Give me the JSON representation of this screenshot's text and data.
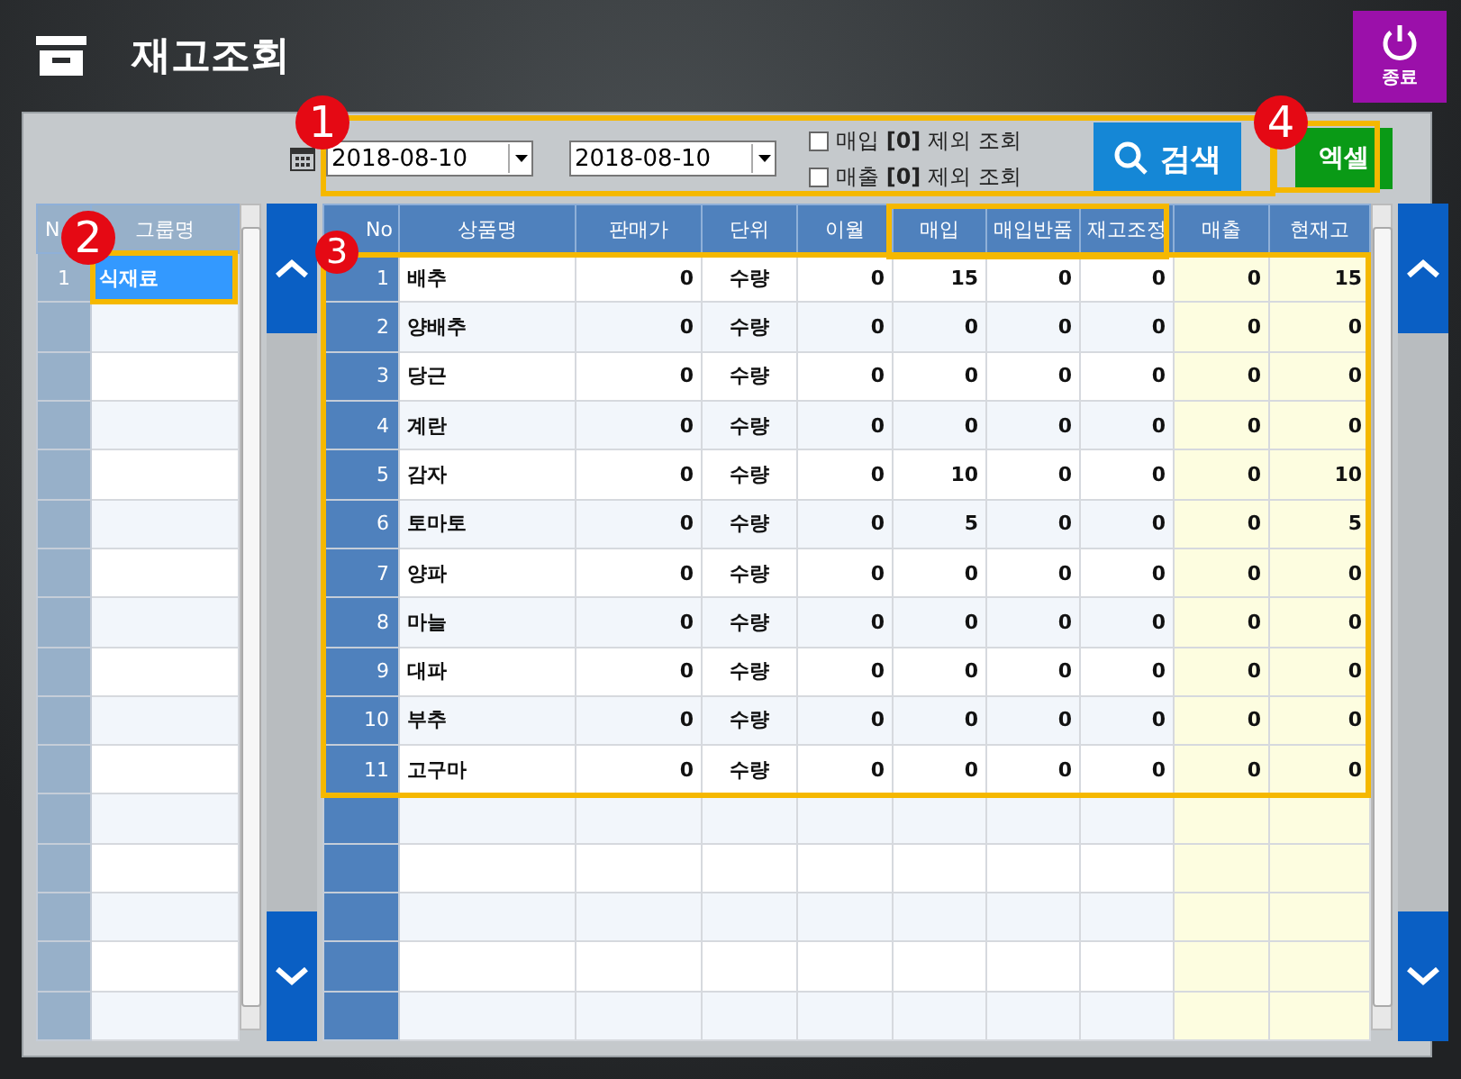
{
  "window": {
    "title": "재고조회"
  },
  "exit_button": {
    "label": "종료"
  },
  "filters": {
    "date_from": "2018-08-10",
    "date_to": "2018-08-10",
    "options": [
      {
        "label": "매입 **[0]** 제외 조회",
        "checked": false
      },
      {
        "label": "매출 **[0]** 제외 조회",
        "checked": false
      }
    ]
  },
  "search_button": {
    "label": "검색"
  },
  "excel_button": {
    "label": "엑셀"
  },
  "groups": {
    "columns": [
      "N",
      "그룹명"
    ],
    "rows": [
      {
        "no": "1",
        "name": "식재료",
        "selected": true
      }
    ]
  },
  "items": {
    "columns": [
      "No",
      "상품명",
      "판매가",
      "단위",
      "이월",
      "매입",
      "매입반품",
      "재고조정",
      "매출",
      "현재고"
    ],
    "rows": [
      [
        "1",
        "배추",
        "0",
        "수량",
        "0",
        "15",
        "0",
        "0",
        "0",
        "15"
      ],
      [
        "2",
        "양배추",
        "0",
        "수량",
        "0",
        "0",
        "0",
        "0",
        "0",
        "0"
      ],
      [
        "3",
        "당근",
        "0",
        "수량",
        "0",
        "0",
        "0",
        "0",
        "0",
        "0"
      ],
      [
        "4",
        "계란",
        "0",
        "수량",
        "0",
        "0",
        "0",
        "0",
        "0",
        "0"
      ],
      [
        "5",
        "감자",
        "0",
        "수량",
        "0",
        "10",
        "0",
        "0",
        "0",
        "10"
      ],
      [
        "6",
        "토마토",
        "0",
        "수량",
        "0",
        "5",
        "0",
        "0",
        "0",
        "5"
      ],
      [
        "7",
        "양파",
        "0",
        "수량",
        "0",
        "0",
        "0",
        "0",
        "0",
        "0"
      ],
      [
        "8",
        "마늘",
        "0",
        "수량",
        "0",
        "0",
        "0",
        "0",
        "0",
        "0"
      ],
      [
        "9",
        "대파",
        "0",
        "수량",
        "0",
        "0",
        "0",
        "0",
        "0",
        "0"
      ],
      [
        "10",
        "부추",
        "0",
        "수량",
        "0",
        "0",
        "0",
        "0",
        "0",
        "0"
      ],
      [
        "11",
        "고구마",
        "0",
        "수량",
        "0",
        "0",
        "0",
        "0",
        "0",
        "0"
      ]
    ]
  },
  "callouts": [
    "1",
    "4",
    "2",
    "3"
  ]
}
